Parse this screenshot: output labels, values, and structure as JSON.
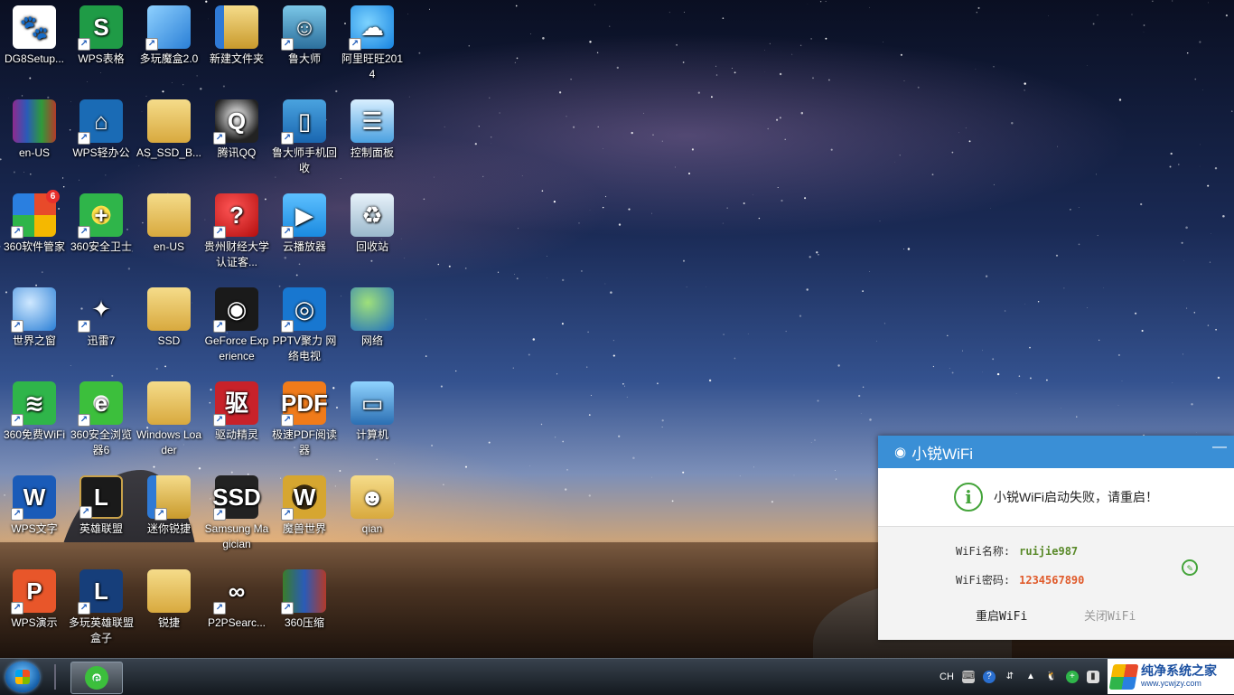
{
  "desktop": {
    "icons": [
      {
        "label": "DG8Setup...",
        "icon": "baidu-paw-icon",
        "glyph": "🐾",
        "style": "i-baidu",
        "shortcut": false
      },
      {
        "label": "WPS表格",
        "icon": "wps-spreadsheet-icon",
        "glyph": "S",
        "style": "i-wps-s",
        "shortcut": true
      },
      {
        "label": "多玩魔盒2.0",
        "icon": "cube-icon",
        "glyph": "",
        "style": "i-cube",
        "shortcut": true
      },
      {
        "label": "新建文件夹",
        "icon": "folder-icon",
        "glyph": "",
        "style": "i-folder-blue",
        "shortcut": false
      },
      {
        "label": "鲁大师",
        "icon": "ludashi-icon",
        "glyph": "☺",
        "style": "i-lu",
        "shortcut": true
      },
      {
        "label": "阿里旺旺2014",
        "icon": "aliwangwang-icon",
        "glyph": "☁",
        "style": "i-ali",
        "shortcut": true
      },
      {
        "label": "en-US",
        "icon": "winrar-icon",
        "glyph": "",
        "style": "i-rar",
        "shortcut": false
      },
      {
        "label": "WPS轻办公",
        "icon": "wps-office-icon",
        "glyph": "⌂",
        "style": "i-wpsq",
        "shortcut": true
      },
      {
        "label": "AS_SSD_B...",
        "icon": "folder-icon",
        "glyph": "",
        "style": "i-folder",
        "shortcut": false
      },
      {
        "label": "腾讯QQ",
        "icon": "qq-penguin-icon",
        "glyph": "Q",
        "style": "i-qq",
        "shortcut": true
      },
      {
        "label": "鲁大师手机回收",
        "icon": "phone-icon",
        "glyph": "▯",
        "style": "i-phone",
        "shortcut": true
      },
      {
        "label": "控制面板",
        "icon": "control-panel-icon",
        "glyph": "☰",
        "style": "i-panel",
        "shortcut": false
      },
      {
        "label": "360软件管家",
        "icon": "360-software-manager-icon",
        "glyph": "",
        "style": "i-360mgr",
        "shortcut": true,
        "badge": "6"
      },
      {
        "label": "360安全卫士",
        "icon": "360-security-icon",
        "glyph": "+",
        "style": "i-360safe",
        "shortcut": true
      },
      {
        "label": "en-US",
        "icon": "folder-icon",
        "glyph": "",
        "style": "i-folder",
        "shortcut": false
      },
      {
        "label": "贵州财经大学认证客...",
        "icon": "guizhou-client-icon",
        "glyph": "?",
        "style": "i-guizhou",
        "shortcut": true
      },
      {
        "label": "云播放器",
        "icon": "cloud-player-icon",
        "glyph": "▶",
        "style": "i-cloud",
        "shortcut": true
      },
      {
        "label": "回收站",
        "icon": "recycle-bin-icon",
        "glyph": "♻",
        "style": "i-bin",
        "shortcut": false
      },
      {
        "label": "世界之窗",
        "icon": "globe-browser-icon",
        "glyph": "",
        "style": "i-globe",
        "shortcut": true
      },
      {
        "label": "迅雷7",
        "icon": "xunlei-bird-icon",
        "glyph": "✦",
        "style": "i-xunlei",
        "shortcut": true
      },
      {
        "label": "SSD",
        "icon": "folder-icon",
        "glyph": "",
        "style": "i-folder",
        "shortcut": false
      },
      {
        "label": "GeForce Experience",
        "icon": "nvidia-icon",
        "glyph": "◉",
        "style": "i-nvidia",
        "shortcut": true
      },
      {
        "label": "PPTV聚力 网络电视",
        "icon": "pptv-icon",
        "glyph": "◎",
        "style": "i-pptv",
        "shortcut": true
      },
      {
        "label": "网络",
        "icon": "network-globe-icon",
        "glyph": "",
        "style": "i-network",
        "shortcut": false
      },
      {
        "label": "360免费WiFi",
        "icon": "wifi-icon",
        "glyph": "≋",
        "style": "i-wifi360",
        "shortcut": true
      },
      {
        "label": "360安全浏览器6",
        "icon": "360-browser-icon",
        "glyph": "e",
        "style": "i-ie360",
        "shortcut": true
      },
      {
        "label": "Windows Loader",
        "icon": "folder-icon",
        "glyph": "",
        "style": "i-folder",
        "shortcut": false
      },
      {
        "label": "驱动精灵",
        "icon": "driver-genius-icon",
        "glyph": "驱",
        "style": "i-drive",
        "shortcut": true
      },
      {
        "label": "极速PDF阅读器",
        "icon": "pdf-reader-icon",
        "glyph": "PDF",
        "style": "i-pdf",
        "shortcut": true
      },
      {
        "label": "计算机",
        "icon": "computer-icon",
        "glyph": "▭",
        "style": "i-computer",
        "shortcut": false
      },
      {
        "label": "WPS文字",
        "icon": "wps-writer-icon",
        "glyph": "W",
        "style": "i-wpsw",
        "shortcut": true
      },
      {
        "label": "英雄联盟",
        "icon": "lol-icon",
        "glyph": "L",
        "style": "i-lol",
        "shortcut": true
      },
      {
        "label": "迷你锐捷",
        "icon": "folder-icon",
        "glyph": "",
        "style": "i-folder-blue",
        "shortcut": true
      },
      {
        "label": "Samsung Magician",
        "icon": "ssd-drive-icon",
        "glyph": "SSD",
        "style": "i-ssd",
        "shortcut": true
      },
      {
        "label": "魔兽世界",
        "icon": "wow-icon",
        "glyph": "W",
        "style": "i-wow",
        "shortcut": true
      },
      {
        "label": "qian",
        "icon": "user-folder-icon",
        "glyph": "☻",
        "style": "i-user",
        "shortcut": false
      },
      {
        "label": "WPS演示",
        "icon": "wps-presentation-icon",
        "glyph": "P",
        "style": "i-wpsp",
        "shortcut": true
      },
      {
        "label": "多玩英雄联盟盒子",
        "icon": "lol-box-icon",
        "glyph": "L",
        "style": "i-lbox",
        "shortcut": true
      },
      {
        "label": "锐捷",
        "icon": "folder-icon",
        "glyph": "",
        "style": "i-folder",
        "shortcut": false
      },
      {
        "label": "P2PSearc...",
        "icon": "binoculars-icon",
        "glyph": "∞",
        "style": "i-p2p",
        "shortcut": true
      },
      {
        "label": "360压缩",
        "icon": "360-zip-icon",
        "glyph": "",
        "style": "i-zip",
        "shortcut": true
      }
    ]
  },
  "wifi_popup": {
    "title": "小锐WiFi",
    "minimize": "—",
    "status_message": "小锐WiFi启动失败，请重启！",
    "name_label": "WiFi名称:",
    "name_value": "ruijie987",
    "password_label": "WiFi密码:",
    "password_value": "1234567890",
    "restart_label": "重启WiFi",
    "close_label": "关闭WiFi",
    "colors": {
      "header": "#3a8fd6",
      "ok_green": "#44a43a",
      "name": "#5a8a2a",
      "password": "#e05a2a"
    }
  },
  "taskbar": {
    "tray": {
      "language": "CH"
    }
  },
  "watermark": {
    "title": "纯净系统之家",
    "url": "www.ycwjzy.com"
  }
}
